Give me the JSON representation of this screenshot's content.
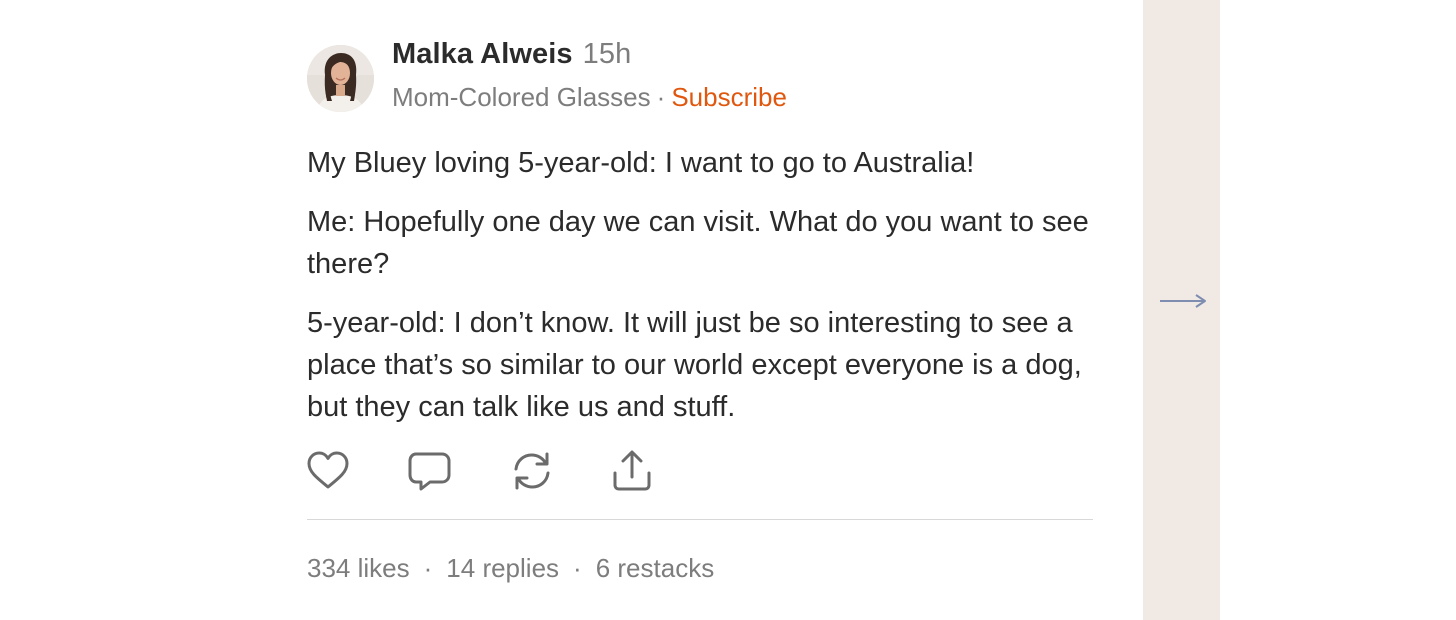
{
  "author": {
    "name": "Malka Alweis",
    "timestamp": "15h",
    "publication": "Mom-Colored Glasses",
    "separator": "·",
    "subscribe_label": "Subscribe"
  },
  "post": {
    "paragraphs": [
      "My Bluey loving 5-year-old: I want to go to Australia!",
      "Me: Hopefully one day we can visit. What do you want to see there?",
      "5-year-old: I don’t know. It will just be so interesting to see a place that’s so similar to our world except everyone is a dog, but they can talk like us and stuff."
    ]
  },
  "actions": {
    "icons": [
      "heart-icon",
      "comment-icon",
      "restack-icon",
      "share-icon"
    ]
  },
  "stats": {
    "likes": "334 likes",
    "replies": "14 replies",
    "restacks": "6 restacks",
    "separator": "·"
  },
  "side_panel": {
    "icon": "arrow-right-icon"
  },
  "colors": {
    "accent": "#e0580f",
    "text": "#2b2b2b",
    "muted": "#7d7d7d",
    "side_panel_bg": "#f1e9e3",
    "arrow": "#7e8db0"
  }
}
